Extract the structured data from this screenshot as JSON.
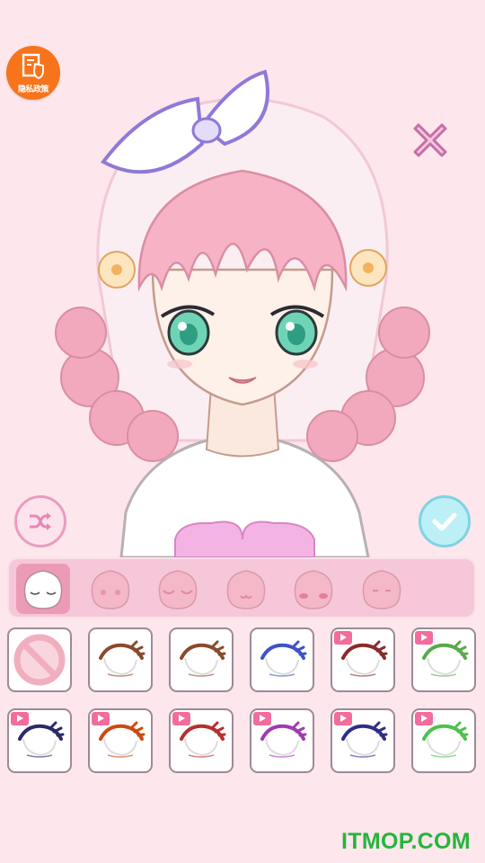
{
  "privacy": {
    "label": "隐私政策"
  },
  "face_tabs": [
    {
      "name": "sleepy-closed",
      "selected": true
    },
    {
      "name": "round-dots",
      "selected": false
    },
    {
      "name": "closed-lashes",
      "selected": false
    },
    {
      "name": "cat-mouth",
      "selected": false
    },
    {
      "name": "blush-lines",
      "selected": false
    },
    {
      "name": "calm-lines",
      "selected": false
    }
  ],
  "eye_options": [
    {
      "name": "none",
      "locked": false
    },
    {
      "name": "brown-lash",
      "locked": false,
      "color": "#8a4a2c"
    },
    {
      "name": "brown-lash-2",
      "locked": false,
      "color": "#8a4a2c"
    },
    {
      "name": "blue-thin",
      "locked": false,
      "color": "#3e52c8"
    },
    {
      "name": "maroon-lash",
      "locked": true,
      "color": "#8a2a2a"
    },
    {
      "name": "green-lash",
      "locked": true,
      "color": "#5aa94a"
    },
    {
      "name": "navy-lash",
      "locked": true,
      "color": "#2a2a6a"
    },
    {
      "name": "orange-lash",
      "locked": true,
      "color": "#cc4a12"
    },
    {
      "name": "red-bow-lash",
      "locked": true,
      "color": "#b82e2e"
    },
    {
      "name": "purple-lash",
      "locked": true,
      "color": "#a03ab0"
    },
    {
      "name": "indigo-lash",
      "locked": true,
      "color": "#2e2e8a"
    },
    {
      "name": "light-green-lash",
      "locked": true,
      "color": "#4fc04f"
    }
  ],
  "colors": {
    "background": "#fde6ec",
    "accent": "#ec9bb6",
    "watermark": "#27b43c",
    "privacy_badge": "#f7741c"
  },
  "watermark": "ITMOP.COM"
}
